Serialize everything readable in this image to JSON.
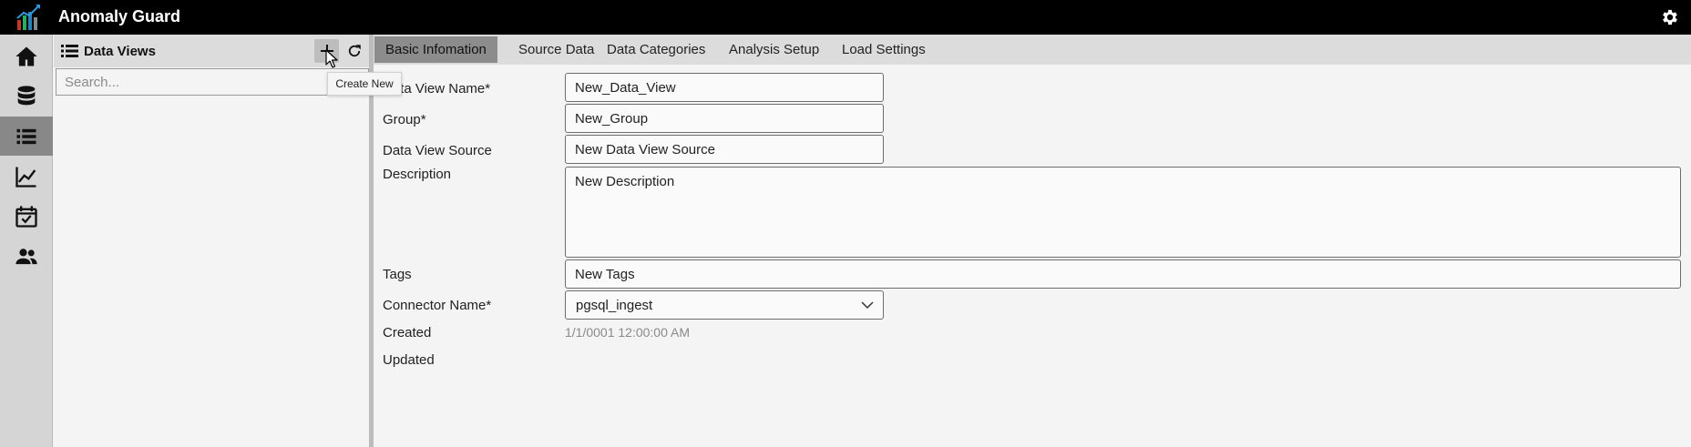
{
  "app": {
    "title": "Anomaly Guard",
    "logo_icon": "bar-chart-logo-icon",
    "settings_icon": "gear-icon"
  },
  "nav": [
    {
      "icon": "home-icon",
      "active": false
    },
    {
      "icon": "database-icon",
      "active": false
    },
    {
      "icon": "list-icon",
      "active": true
    },
    {
      "icon": "line-chart-icon",
      "active": false
    },
    {
      "icon": "calendar-check-icon",
      "active": false
    },
    {
      "icon": "users-icon",
      "active": false
    }
  ],
  "list_panel": {
    "title": "Data Views",
    "search_placeholder": "Search...",
    "add_tooltip": "Create New"
  },
  "tabs": [
    {
      "label": "Basic Infomation",
      "active": true
    },
    {
      "label": "Source Data",
      "active": false
    },
    {
      "label": "Data Categories",
      "active": false
    },
    {
      "label": "Analysis Setup",
      "active": false
    },
    {
      "label": "Load Settings",
      "active": false
    }
  ],
  "form": {
    "name_label": "Data View Name*",
    "name_value": "New_Data_View",
    "group_label": "Group*",
    "group_value": "New_Group",
    "source_label": "Data View Source",
    "source_value": "New Data View Source",
    "description_label": "Description",
    "description_value": "New Description",
    "tags_label": "Tags",
    "tags_value": "New Tags",
    "connector_label": "Connector Name*",
    "connector_value": "pgsql_ingest",
    "created_label": "Created",
    "created_value": "1/1/0001 12:00:00 AM",
    "updated_label": "Updated",
    "updated_value": ""
  },
  "colors": {
    "topbar": "#000000",
    "active_nav": "#888888",
    "active_tab": "#8c8c8c"
  }
}
